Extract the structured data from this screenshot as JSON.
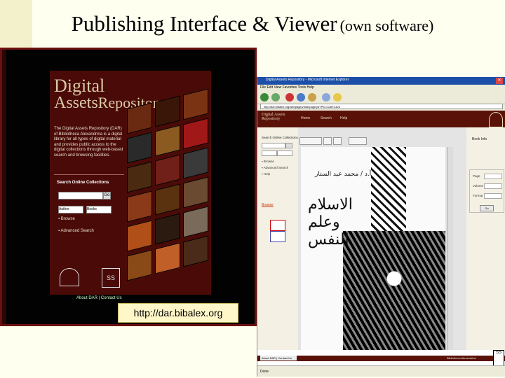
{
  "slide": {
    "title_main": "Publishing Interface & Viewer",
    "title_sub": "(own software)"
  },
  "portal": {
    "logo_line1": "Digital",
    "logo_line2a": "Assets",
    "logo_line2b": "Repository",
    "intro": "The Digital Assets Repository (DAR) of Bibliotheca Alexandrina is a digital library for all types of digital material and provides public access to the digital collections through web-based search and browsing facilities.",
    "search_title": "Search Online Collections",
    "search_go": "Go",
    "select_1": "Author",
    "select_2": "Books",
    "link_browse": "Browse",
    "link_advanced": "Advanced Search",
    "footer": "About DAR | Contact Us",
    "url": "http://dar.bibalex.org",
    "logo_b_text": "SS"
  },
  "viewer": {
    "window_title": "Digital Assets Repository - Microsoft Internet Explorer",
    "menu": "File  Edit  View  Favorites  Tools  Help",
    "address": "http://dar.bibalex.org/webpages/mainpage.jsf?PID=DAR:4420",
    "logo": "Digital Assets Repository",
    "tabs": [
      "Home",
      "Search",
      "Help"
    ],
    "sidebar_title": "Search Online Collections",
    "sidebar_options": [
      "Browse",
      "Advanced Search",
      "Help"
    ],
    "sidebar_link": "Browse",
    "right_title": "Book Info",
    "right_labels": [
      "Page",
      "Volume",
      "Format"
    ],
    "right_button": "Go",
    "footer_button": "About DAR | Contact Us",
    "footer_text": "Bibliotheca Alexandrina",
    "callig_small": "أ.د / محمد عبد الستار",
    "callig_big": "الاسلام وعلم النفس",
    "status": "Done"
  },
  "colors": {
    "slide_bg": "#fffff0",
    "portal_bg": "#4a0b08",
    "url_bg": "#fff7c8",
    "viewer_header": "#5a1208",
    "titlebar": "#1c4fa8"
  }
}
